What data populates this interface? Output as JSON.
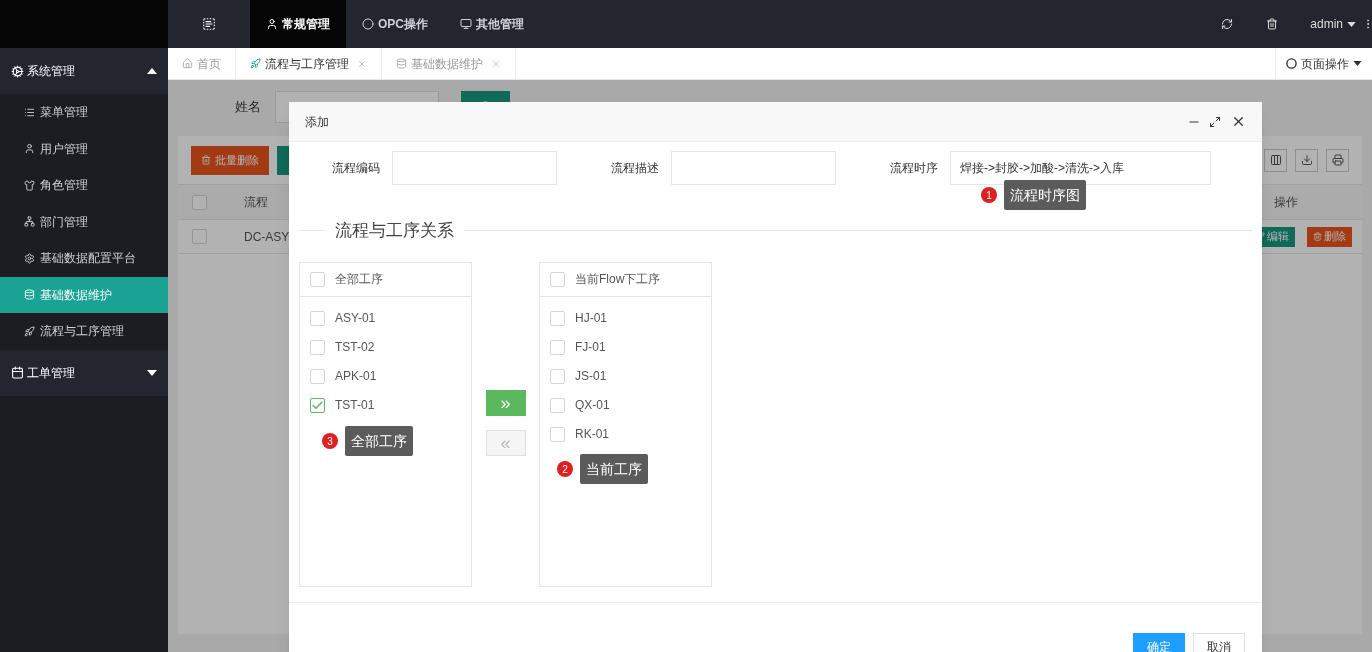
{
  "top_nav": {
    "items": [
      {
        "label": "常规管理",
        "selected": true
      },
      {
        "label": "OPC操作",
        "selected": false
      },
      {
        "label": "其他管理",
        "selected": false
      }
    ],
    "user": "admin"
  },
  "sidebar": {
    "groups": [
      {
        "label": "系统管理",
        "expanded": true,
        "children": [
          {
            "label": "菜单管理",
            "selected": false
          },
          {
            "label": "用户管理",
            "selected": false
          },
          {
            "label": "角色管理",
            "selected": false
          },
          {
            "label": "部门管理",
            "selected": false
          },
          {
            "label": "基础数据配置平台",
            "selected": false
          },
          {
            "label": "基础数据维护",
            "selected": true
          },
          {
            "label": "流程与工序管理",
            "selected": false
          }
        ]
      },
      {
        "label": "工单管理",
        "expanded": false
      }
    ]
  },
  "tabs": [
    {
      "label": "首页",
      "selected": false,
      "closable": false
    },
    {
      "label": "流程与工序管理",
      "selected": true,
      "closable": true
    },
    {
      "label": "基础数据维护",
      "selected": false,
      "closable": true
    }
  ],
  "page_actions": "页面操作",
  "background": {
    "search_label": "姓名",
    "batch_delete": "批量删除",
    "header_checked": false,
    "columns": [
      "流程",
      "操作"
    ],
    "rows": [
      {
        "checked": false,
        "code": "DC-ASY",
        "edit": "编辑",
        "delete": "删除"
      }
    ]
  },
  "dialog": {
    "title": "添加",
    "fields": [
      {
        "label": "流程编码"
      },
      {
        "label": "流程描述"
      },
      {
        "label": "流程时序",
        "value": "焊接->封胶->加酸->清洗->入库"
      }
    ],
    "legend": "流程与工序关系",
    "left_list": {
      "header": "全部工序",
      "checked": false,
      "items": [
        {
          "label": "ASY-01",
          "checked": false
        },
        {
          "label": "TST-02",
          "checked": false
        },
        {
          "label": "APK-01",
          "checked": false
        },
        {
          "label": "TST-01",
          "checked": true
        }
      ]
    },
    "move_buttons": [
      {
        "label": "»",
        "disabled": false
      },
      {
        "label": "«",
        "disabled": true
      }
    ],
    "right_list": {
      "header": "当前Flow下工序",
      "checked": false,
      "items": [
        {
          "label": "HJ-01",
          "checked": false
        },
        {
          "label": "FJ-01",
          "checked": false
        },
        {
          "label": "JS-01",
          "checked": false
        },
        {
          "label": "QX-01",
          "checked": false
        },
        {
          "label": "RK-01",
          "checked": false
        }
      ]
    },
    "callouts": [
      {
        "number": "1",
        "text": "流程时序图"
      },
      {
        "number": "3",
        "text": "全部工序"
      },
      {
        "number": "2",
        "text": "当前工序"
      }
    ],
    "buttons": [
      {
        "label": "确定",
        "kind": "primary"
      },
      {
        "label": "取消",
        "kind": "default"
      }
    ]
  }
}
